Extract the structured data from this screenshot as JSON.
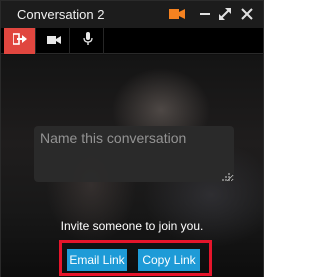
{
  "window": {
    "title": "Conversation 2"
  },
  "titlebar_icons": {
    "camera": "camera-icon",
    "minimize": "minimize-icon",
    "maximize": "maximize-icon",
    "close": "close-icon"
  },
  "toolbar": {
    "items": [
      {
        "icon": "sign-out-icon",
        "active": true
      },
      {
        "icon": "video-camera-icon",
        "active": false
      },
      {
        "icon": "microphone-icon",
        "active": false
      }
    ]
  },
  "conversation": {
    "name_placeholder": "Name this conversation",
    "name_value": ""
  },
  "invite": {
    "text": "Invite someone to join you.",
    "email_label": "Email Link",
    "copy_label": "Copy Link"
  },
  "colors": {
    "accent_orange": "#f58220",
    "active_tool": "#e0463f",
    "button_blue": "#1e9bd7",
    "highlight_red": "#e6152b"
  }
}
